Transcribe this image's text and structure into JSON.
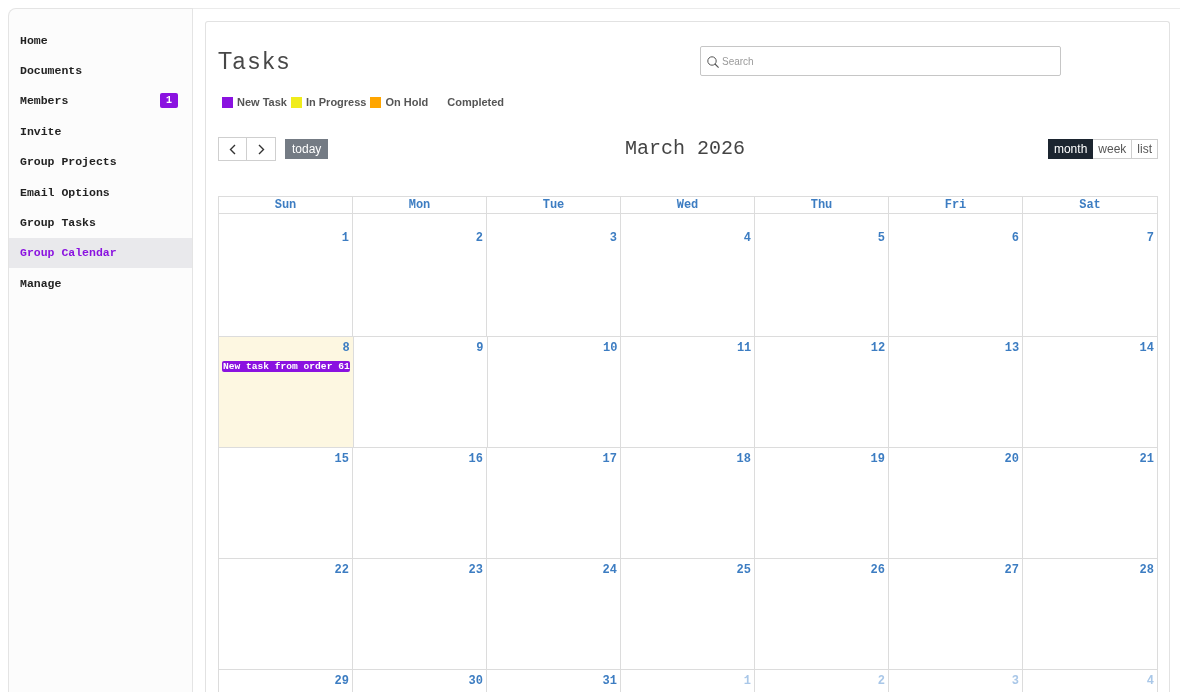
{
  "sidebar": {
    "items": [
      {
        "label": "Home",
        "selected": false
      },
      {
        "label": "Documents",
        "selected": false
      },
      {
        "label": "Members",
        "selected": false,
        "badge": "1"
      },
      {
        "label": "Invite",
        "selected": false
      },
      {
        "label": "Group Projects",
        "selected": false
      },
      {
        "label": "Email Options",
        "selected": false
      },
      {
        "label": "Group Tasks",
        "selected": false
      },
      {
        "label": "Group Calendar",
        "selected": true
      },
      {
        "label": "Manage",
        "selected": false
      }
    ]
  },
  "header": {
    "title": "Tasks",
    "search": {
      "placeholder": "Search"
    }
  },
  "legend": [
    {
      "label": "New Task",
      "color": "#8a12e0"
    },
    {
      "label": "In Progress",
      "color": "#f0ec1c"
    },
    {
      "label": "On Hold",
      "color": "#ffa500"
    },
    {
      "label": "Completed"
    }
  ],
  "toolbar": {
    "nav_buttons": [
      {
        "kind": "prev"
      },
      {
        "kind": "next"
      }
    ],
    "today_button": "today",
    "title": "March 2026",
    "views": [
      {
        "label": "month",
        "selected": true
      },
      {
        "label": "week",
        "selected": false
      },
      {
        "label": "list",
        "selected": false
      }
    ]
  },
  "calendar": {
    "weekdays": [
      "Sun",
      "Mon",
      "Tue",
      "Wed",
      "Thu",
      "Fri",
      "Sat"
    ],
    "weeks": [
      {
        "days": [
          {
            "day": "1",
            "other_month": false,
            "today": false
          },
          {
            "day": "2",
            "other_month": false,
            "today": false
          },
          {
            "day": "3",
            "other_month": false,
            "today": false
          },
          {
            "day": "4",
            "other_month": false,
            "today": false
          },
          {
            "day": "5",
            "other_month": false,
            "today": false
          },
          {
            "day": "6",
            "other_month": false,
            "today": false
          },
          {
            "day": "7",
            "other_month": false,
            "today": false
          }
        ]
      },
      {
        "days": [
          {
            "day": "8",
            "other_month": false,
            "today": true,
            "events": [
              {
                "title": "New task from order 61",
                "color": "#8a12e0"
              }
            ]
          },
          {
            "day": "9",
            "other_month": false,
            "today": false
          },
          {
            "day": "10",
            "other_month": false,
            "today": false
          },
          {
            "day": "11",
            "other_month": false,
            "today": false
          },
          {
            "day": "12",
            "other_month": false,
            "today": false
          },
          {
            "day": "13",
            "other_month": false,
            "today": false
          },
          {
            "day": "14",
            "other_month": false,
            "today": false
          }
        ]
      },
      {
        "days": [
          {
            "day": "15",
            "other_month": false,
            "today": false
          },
          {
            "day": "16",
            "other_month": false,
            "today": false
          },
          {
            "day": "17",
            "other_month": false,
            "today": false
          },
          {
            "day": "18",
            "other_month": false,
            "today": false
          },
          {
            "day": "19",
            "other_month": false,
            "today": false
          },
          {
            "day": "20",
            "other_month": false,
            "today": false
          },
          {
            "day": "21",
            "other_month": false,
            "today": false
          }
        ]
      },
      {
        "days": [
          {
            "day": "22",
            "other_month": false,
            "today": false
          },
          {
            "day": "23",
            "other_month": false,
            "today": false
          },
          {
            "day": "24",
            "other_month": false,
            "today": false
          },
          {
            "day": "25",
            "other_month": false,
            "today": false
          },
          {
            "day": "26",
            "other_month": false,
            "today": false
          },
          {
            "day": "27",
            "other_month": false,
            "today": false
          },
          {
            "day": "28",
            "other_month": false,
            "today": false
          }
        ]
      },
      {
        "days": [
          {
            "day": "29",
            "other_month": false,
            "today": false
          },
          {
            "day": "30",
            "other_month": false,
            "today": false
          },
          {
            "day": "31",
            "other_month": false,
            "today": false
          },
          {
            "day": "1",
            "other_month": true,
            "today": false
          },
          {
            "day": "2",
            "other_month": true,
            "today": false
          },
          {
            "day": "3",
            "other_month": true,
            "today": false
          },
          {
            "day": "4",
            "other_month": true,
            "today": false
          }
        ]
      }
    ]
  }
}
